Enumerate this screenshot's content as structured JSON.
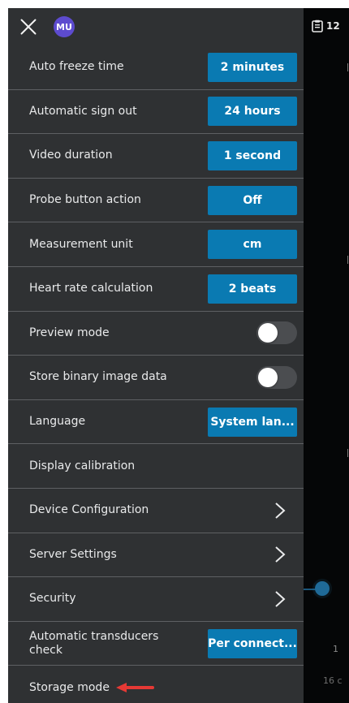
{
  "header": {
    "avatar_initials": "MU"
  },
  "settings": {
    "rows": [
      {
        "label": "Auto freeze time",
        "value": "2 minutes"
      },
      {
        "label": "Automatic sign out",
        "value": "24 hours"
      },
      {
        "label": "Video duration",
        "value": "1 second"
      },
      {
        "label": "Probe button action",
        "value": "Off"
      },
      {
        "label": "Measurement unit",
        "value": "cm"
      },
      {
        "label": "Heart rate calculation",
        "value": "2 beats"
      },
      {
        "label": "Preview mode",
        "toggle": "off"
      },
      {
        "label": "Store binary image data",
        "toggle": "off"
      },
      {
        "label": "Language",
        "value": "System lan..."
      },
      {
        "label": "Display calibration"
      },
      {
        "label": "Device Configuration"
      },
      {
        "label": "Server Settings"
      },
      {
        "label": "Security"
      },
      {
        "label": "Automatic transducers check",
        "value": "Per connect..."
      },
      {
        "label": "Storage mode"
      }
    ]
  },
  "viewer": {
    "clip_count": "12",
    "depth_readout": "16 c",
    "side_marker": "1"
  },
  "colors": {
    "menu_bg": "#2f3133",
    "button_blue": "#0a7ab2",
    "divider": "#5e6063",
    "avatar": "#5d4bcf",
    "annotation_arrow": "#e53935"
  }
}
